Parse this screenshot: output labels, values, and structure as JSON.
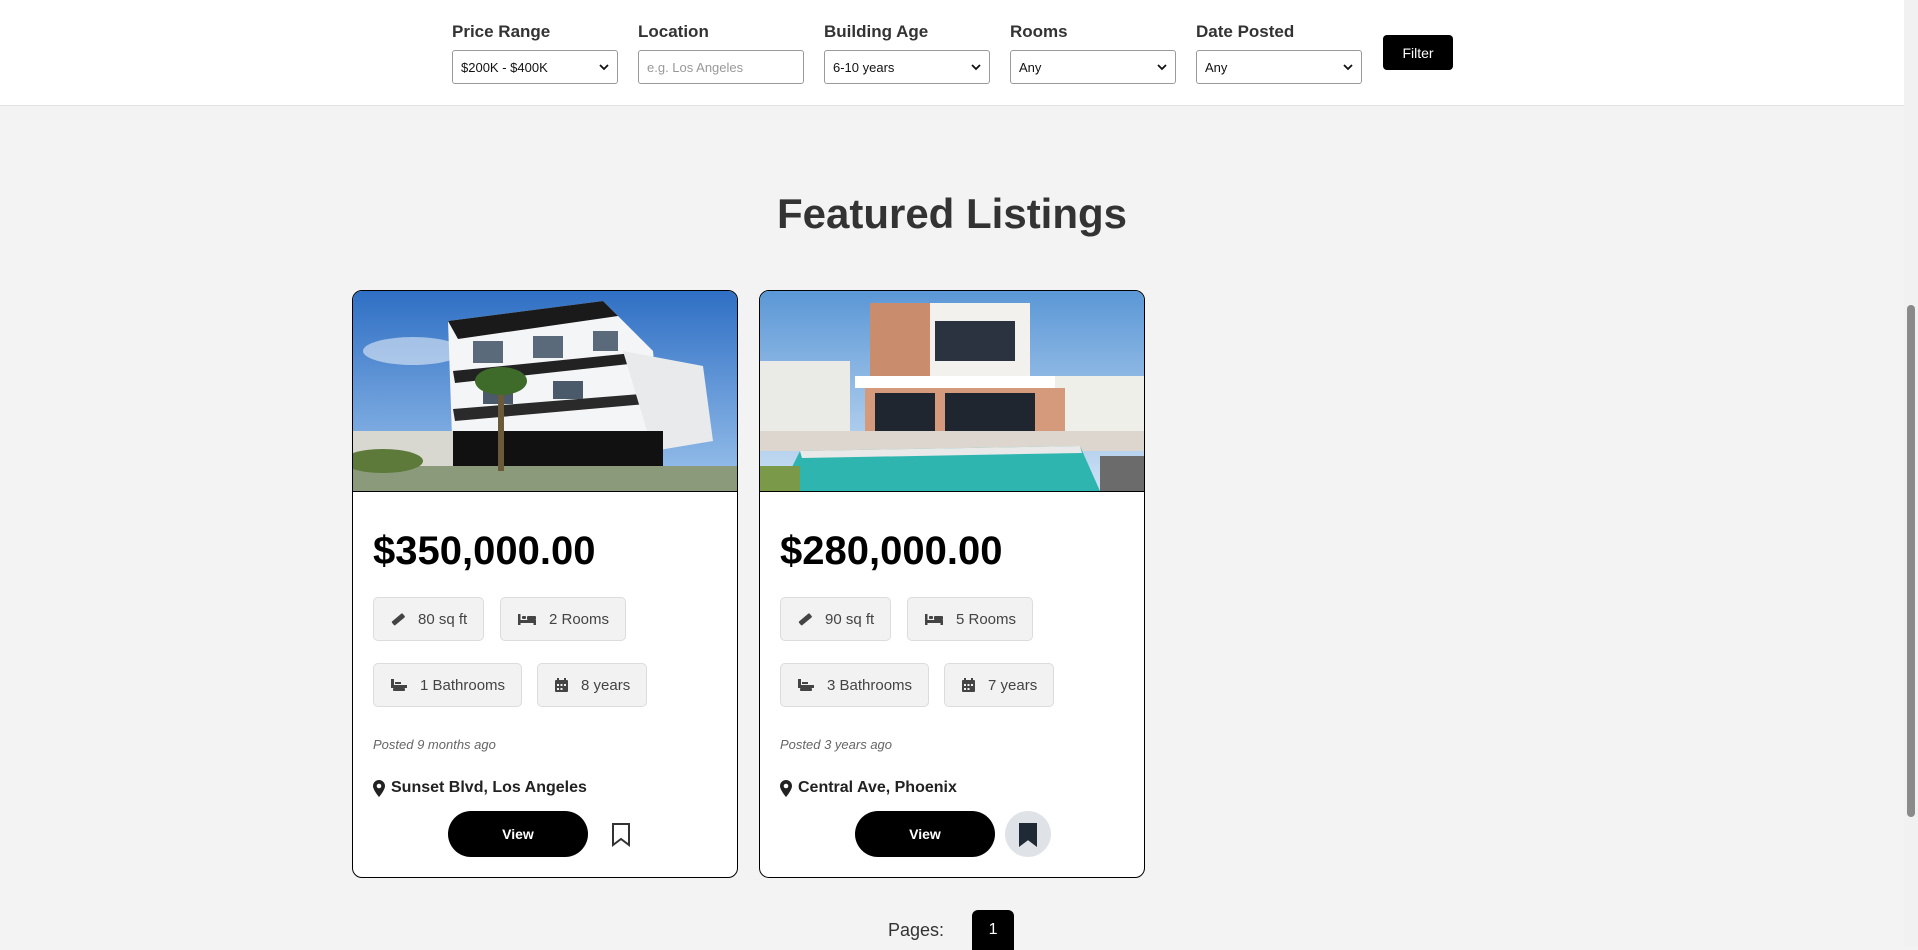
{
  "filters": {
    "price_range": {
      "label": "Price Range",
      "value": "$200K - $400K"
    },
    "location": {
      "label": "Location",
      "placeholder": "e.g. Los Angeles"
    },
    "building_age": {
      "label": "Building Age",
      "value": "6-10 years"
    },
    "rooms": {
      "label": "Rooms",
      "value": "Any"
    },
    "date_posted": {
      "label": "Date Posted",
      "value": "Any"
    },
    "button_label": "Filter"
  },
  "section_title": "Featured Listings",
  "listings": [
    {
      "price": "$350,000.00",
      "area": "80 sq ft",
      "rooms": "2 Rooms",
      "bathrooms": "1 Bathrooms",
      "age": "8 years",
      "posted": "Posted 9 months ago",
      "location": "Sunset Blvd, Los Angeles",
      "view_label": "View",
      "saved": false
    },
    {
      "price": "$280,000.00",
      "area": "90 sq ft",
      "rooms": "5 Rooms",
      "bathrooms": "3 Bathrooms",
      "age": "7 years",
      "posted": "Posted 3 years ago",
      "location": "Central Ave, Phoenix",
      "view_label": "View",
      "saved": true
    }
  ],
  "pagination": {
    "label": "Pages:",
    "current": "1"
  },
  "icons": {
    "area": "ruler-icon",
    "rooms": "bed-icon",
    "bathrooms": "bath-icon",
    "age": "calendar-icon",
    "location": "map-pin-icon",
    "bookmark": "bookmark-icon"
  }
}
